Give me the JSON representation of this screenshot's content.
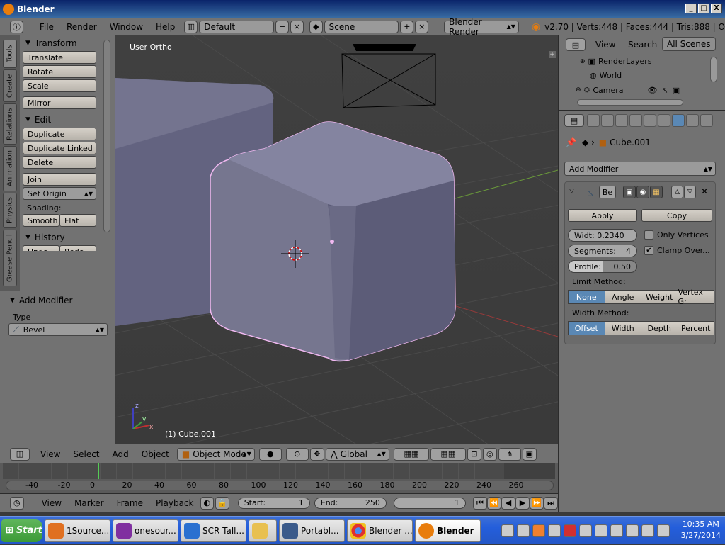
{
  "window": {
    "title": "Blender",
    "min": "_",
    "max": "□",
    "close": "X"
  },
  "menubar": {
    "menus": [
      "File",
      "Render",
      "Window",
      "Help"
    ],
    "layout": "Default",
    "scene": "Scene",
    "engine": "Blender Render",
    "stats": "v2.70 | Verts:448 | Faces:444 | Tris:888 | O"
  },
  "lefttabs": [
    "Tools",
    "Create",
    "Relations",
    "Animation",
    "Physics",
    "Grease Pencil"
  ],
  "toolshelf": {
    "transform_title": "Transform",
    "translate": "Translate",
    "rotate": "Rotate",
    "scale": "Scale",
    "mirror": "Mirror",
    "edit_title": "Edit",
    "duplicate": "Duplicate",
    "duplicate_linked": "Duplicate Linked",
    "delete": "Delete",
    "join": "Join",
    "set_origin": "Set Origin",
    "shading_label": "Shading:",
    "smooth": "Smooth",
    "flat": "Flat",
    "history_title": "History",
    "undo": "Undo",
    "redo": "Redo"
  },
  "operator": {
    "title": "Add Modifier",
    "type_label": "Type",
    "type_value": "Bevel"
  },
  "viewport": {
    "view_label": "User Ortho",
    "object_label": "(1) Cube.001",
    "axis_z": "z",
    "axis_x": "x",
    "axis_y": "y"
  },
  "outliner": {
    "view": "View",
    "search": "Search",
    "scenes": "All Scenes",
    "items": [
      "RenderLayers",
      "World",
      "Camera"
    ]
  },
  "properties": {
    "object_name": "Cube.001",
    "add_modifier": "Add Modifier",
    "mod_short_name": "Be",
    "apply": "Apply",
    "copy": "Copy",
    "width": "Widt: 0.2340",
    "segments_label": "Segments:",
    "segments_value": "4",
    "profile_label": "Profile:",
    "profile_value": "0.50",
    "only_vertices": "Only Vertices",
    "clamp_overlap": "Clamp Over...",
    "limit_method_label": "Limit Method:",
    "limit_methods": [
      "None",
      "Angle",
      "Weight",
      "Vertex Gr"
    ],
    "width_method_label": "Width Method:",
    "width_methods": [
      "Offset",
      "Width",
      "Depth",
      "Percent"
    ]
  },
  "vheader": {
    "view": "View",
    "select": "Select",
    "add": "Add",
    "object": "Object",
    "mode": "Object Mode",
    "orientation": "Global"
  },
  "timeline": {
    "ticks": [
      "-40",
      "-20",
      "0",
      "20",
      "40",
      "60",
      "80",
      "100",
      "120",
      "140",
      "160",
      "180",
      "200",
      "220",
      "240",
      "260"
    ]
  },
  "tlheader": {
    "view": "View",
    "marker": "Marker",
    "frame": "Frame",
    "playback": "Playback",
    "start_label": "Start:",
    "start_value": "1",
    "end_label": "End:",
    "end_value": "250",
    "current": "1"
  },
  "taskbar": {
    "start": "Start",
    "tasks": [
      "1Source...",
      "onesour...",
      "SCR Tall...",
      "",
      "Portabl...",
      "Blender ...",
      "Blender"
    ],
    "time": "10:35 AM",
    "date": "3/27/2014"
  }
}
